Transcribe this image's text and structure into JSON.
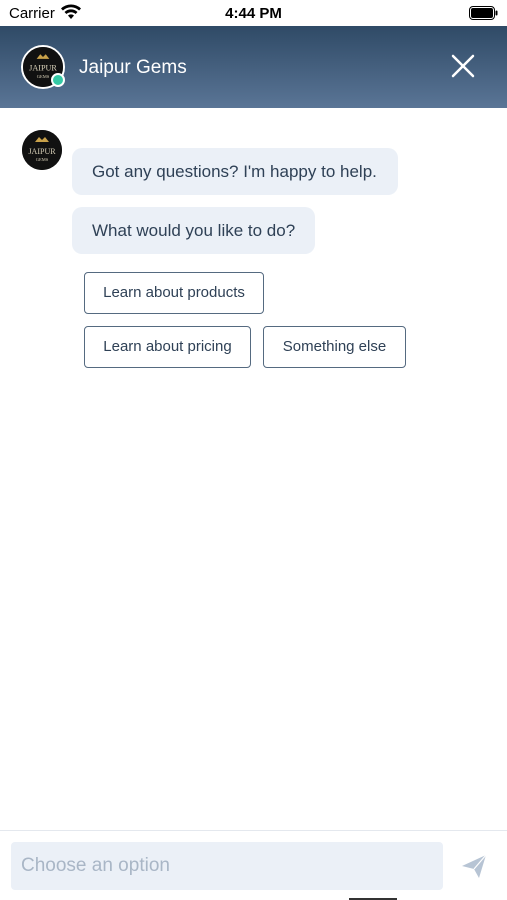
{
  "status_bar": {
    "carrier": "Carrier",
    "time": "4:44 PM",
    "icons": [
      "wifi-icon",
      "battery-icon"
    ]
  },
  "header": {
    "title": "Jaipur Gems",
    "avatar_logo_text": "JAIPUR",
    "avatar_logo_subtext": "GEMS",
    "online_status_color": "#35c9a5",
    "close_icon": "close-icon",
    "gradient": [
      "#2f4a66",
      "#5a7596"
    ]
  },
  "conversation": {
    "bot_avatar_logo_text": "JAIPUR",
    "bot_avatar_logo_subtext": "GEMS",
    "messages": [
      {
        "text": "Got any questions? I'm happy to help."
      },
      {
        "text": "What would you like to do?"
      }
    ],
    "options": [
      {
        "label": "Learn about products"
      },
      {
        "label": "Learn about pricing"
      },
      {
        "label": "Something else"
      }
    ]
  },
  "composer": {
    "placeholder": "Choose an option",
    "value": "",
    "send_icon": "send-icon"
  },
  "colors": {
    "bubble_background": "#ebf0f7",
    "text": "#2f4156",
    "option_border": "#556a80"
  }
}
